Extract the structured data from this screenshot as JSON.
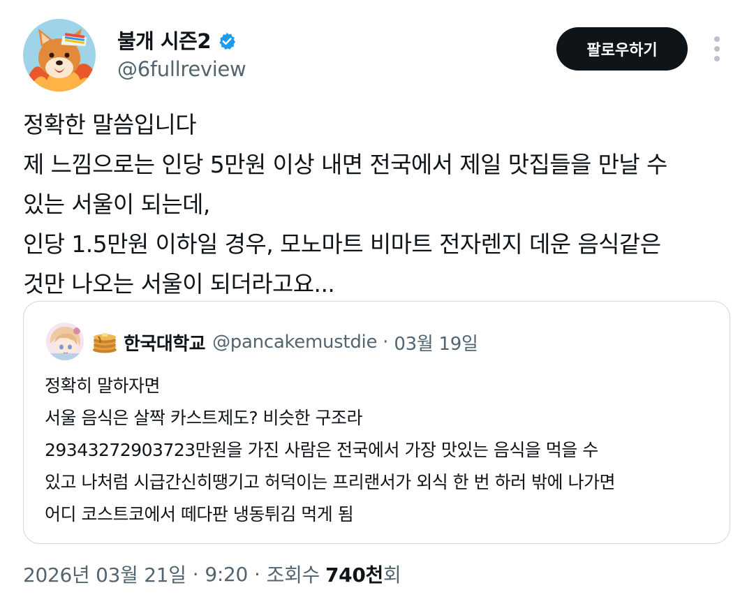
{
  "author": {
    "display_name": "불개 시즌2",
    "handle": "@6fullreview",
    "verified": true,
    "avatar": "shiba-dog-flames-avatar"
  },
  "actions": {
    "follow_label": "팔로우하기",
    "more_icon": "vertical-dots-icon"
  },
  "tweet": {
    "lines": [
      "정확한 말씀입니다",
      "제 느낌으로는 인당 5만원 이상 내면 전국에서 제일 맛집들을 만날 수",
      "있는 서울이 되는데,",
      "인당 1.5만원 이하일 경우, 모노마트 비마트 전자렌지 데운 음식같은",
      "것만 나오는 서울이 되더라고요..."
    ]
  },
  "quote": {
    "avatar": "anime-character-avatar",
    "badge_icon": "pancake-icon",
    "display_name": "한국대학교",
    "handle": "@pancakemustdie",
    "separator": "·",
    "date": "03월 19일",
    "lines": [
      "정확히 말하자면",
      "서울 음식은 살짝 카스트제도? 비슷한 구조라",
      "29343272903723만원을 가진 사람은 전국에서 가장 맛있는 음식을 먹을 수",
      "있고 나처럼 시급간신히땡기고 허덕이는 프리랜서가 외식 한 번 하러 밖에 나가면",
      "어디 코스트코에서 떼다판 냉동튀김 먹게 됨"
    ]
  },
  "meta": {
    "date": "2026년 03월 21일",
    "separator": "·",
    "time": "9:20",
    "views_label": "조회수",
    "views_count": "740천",
    "views_suffix": "회"
  },
  "colors": {
    "text": "#0f1419",
    "secondary": "#536471",
    "verified": "#1d9bf0",
    "button_bg": "#0f1419",
    "border": "#cfd9de"
  }
}
